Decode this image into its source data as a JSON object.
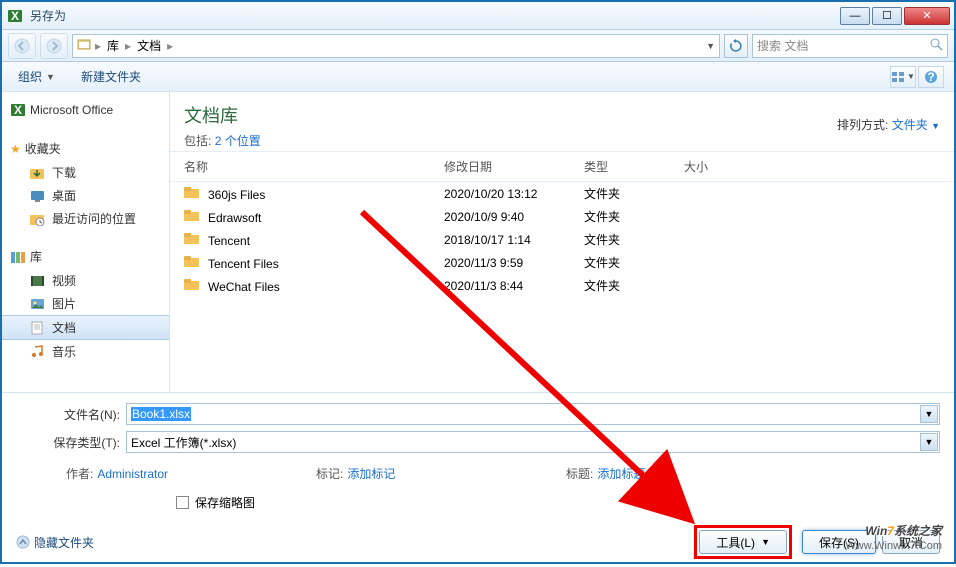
{
  "window": {
    "title": "另存为"
  },
  "breadcrumb": {
    "root_icon": "computer",
    "items": [
      "库",
      "文档"
    ]
  },
  "search": {
    "placeholder": "搜索 文档"
  },
  "toolbar": {
    "organize": "组织",
    "new_folder": "新建文件夹"
  },
  "sidebar": {
    "groups": [
      {
        "title": "Microsoft Office",
        "icon": "excel"
      },
      {
        "title": "收藏夹",
        "icon": "star",
        "items": [
          {
            "icon": "download",
            "label": "下载"
          },
          {
            "icon": "desktop",
            "label": "桌面"
          },
          {
            "icon": "recent",
            "label": "最近访问的位置"
          }
        ]
      },
      {
        "title": "库",
        "icon": "library",
        "items": [
          {
            "icon": "video",
            "label": "视频"
          },
          {
            "icon": "picture",
            "label": "图片"
          },
          {
            "icon": "document",
            "label": "文档",
            "selected": true
          },
          {
            "icon": "music",
            "label": "音乐"
          }
        ]
      }
    ]
  },
  "library_header": {
    "title": "文档库",
    "includes_label": "包括:",
    "includes_link": "2 个位置",
    "sort_label": "排列方式:",
    "sort_value": "文件夹"
  },
  "columns": {
    "name": "名称",
    "date": "修改日期",
    "type": "类型",
    "size": "大小"
  },
  "rows": [
    {
      "name": "360js Files",
      "date": "2020/10/20 13:12",
      "type": "文件夹"
    },
    {
      "name": "Edrawsoft",
      "date": "2020/10/9 9:40",
      "type": "文件夹"
    },
    {
      "name": "Tencent",
      "date": "2018/10/17 1:14",
      "type": "文件夹"
    },
    {
      "name": "Tencent Files",
      "date": "2020/11/3 9:59",
      "type": "文件夹"
    },
    {
      "name": "WeChat Files",
      "date": "2020/11/3 8:44",
      "type": "文件夹"
    }
  ],
  "fields": {
    "filename_label": "文件名(N):",
    "filename_value": "Book1.xlsx",
    "savetype_label": "保存类型(T):",
    "savetype_value": "Excel 工作簿(*.xlsx)"
  },
  "meta": {
    "author_label": "作者:",
    "author_value": "Administrator",
    "tags_label": "标记:",
    "tags_value": "添加标记",
    "title_label": "标题:",
    "title_value": "添加标题",
    "thumbnail_label": "保存缩略图"
  },
  "footer": {
    "hide_folders": "隐藏文件夹",
    "tools": "工具(L)",
    "save": "保存(S)",
    "cancel": "取消"
  },
  "watermark": {
    "line1a": "Win",
    "line1b": "7",
    "line1c": "系统之家",
    "line2": "Www.Winwin7.Com"
  }
}
